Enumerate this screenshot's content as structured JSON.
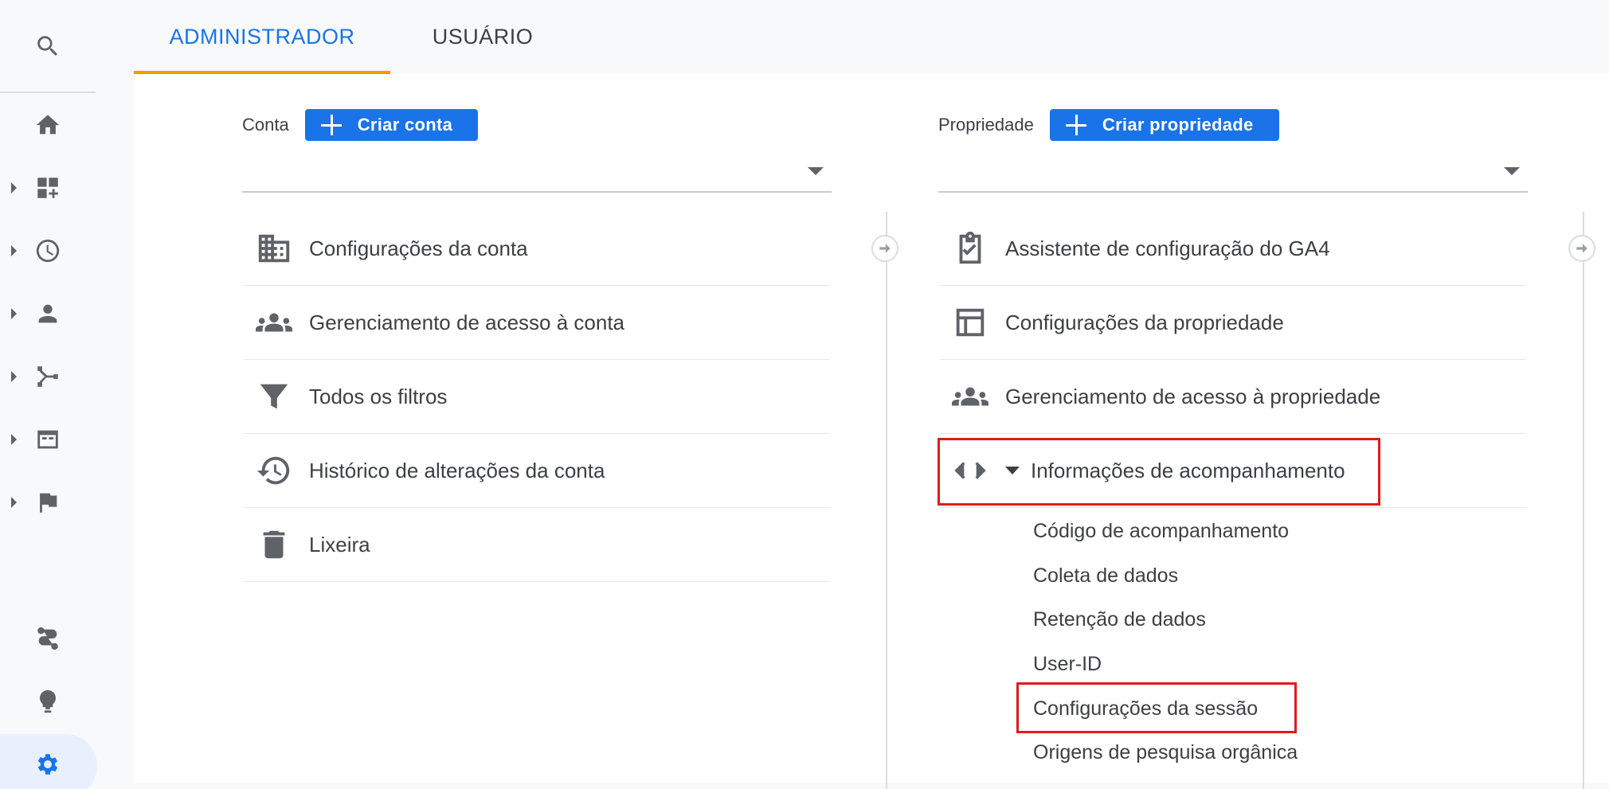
{
  "tabs": [
    {
      "label": "ADMINISTRADOR",
      "active": true
    },
    {
      "label": "USUÁRIO",
      "active": false
    }
  ],
  "nav": {
    "icons": [
      "search-icon",
      "home-icon",
      "customization-icon",
      "realtime-icon",
      "audience-icon",
      "acquisition-icon",
      "behavior-icon",
      "conversions-icon",
      "attribution-icon",
      "discover-icon",
      "admin-gear-icon"
    ]
  },
  "account": {
    "label": "Conta",
    "create_button": "Criar conta",
    "items": [
      {
        "label": "Configurações da conta",
        "icon": "building-icon"
      },
      {
        "label": "Gerenciamento de acesso à conta",
        "icon": "people-icon"
      },
      {
        "label": "Todos os filtros",
        "icon": "filter-icon"
      },
      {
        "label": "Histórico de alterações da conta",
        "icon": "history-icon"
      },
      {
        "label": "Lixeira",
        "icon": "trash-icon"
      }
    ]
  },
  "property": {
    "label": "Propriedade",
    "create_button": "Criar propriedade",
    "items": [
      {
        "label": "Assistente de configuração do GA4",
        "icon": "clipboard-check-icon"
      },
      {
        "label": "Configurações da propriedade",
        "icon": "layout-icon"
      },
      {
        "label": "Gerenciamento de acesso à propriedade",
        "icon": "people-icon"
      },
      {
        "label": "Informações de acompanhamento",
        "icon": "code-icon",
        "expanded": true
      }
    ],
    "tracking_subitems": [
      "Código de acompanhamento",
      "Coleta de dados",
      "Retenção de dados",
      "User-ID",
      "Configurações da sessão",
      "Origens de pesquisa orgânica"
    ]
  },
  "colors": {
    "accent": "#1a73e8",
    "tab_underline": "#f29900",
    "highlight": "#e01b1b",
    "icon": "#5f6368"
  }
}
